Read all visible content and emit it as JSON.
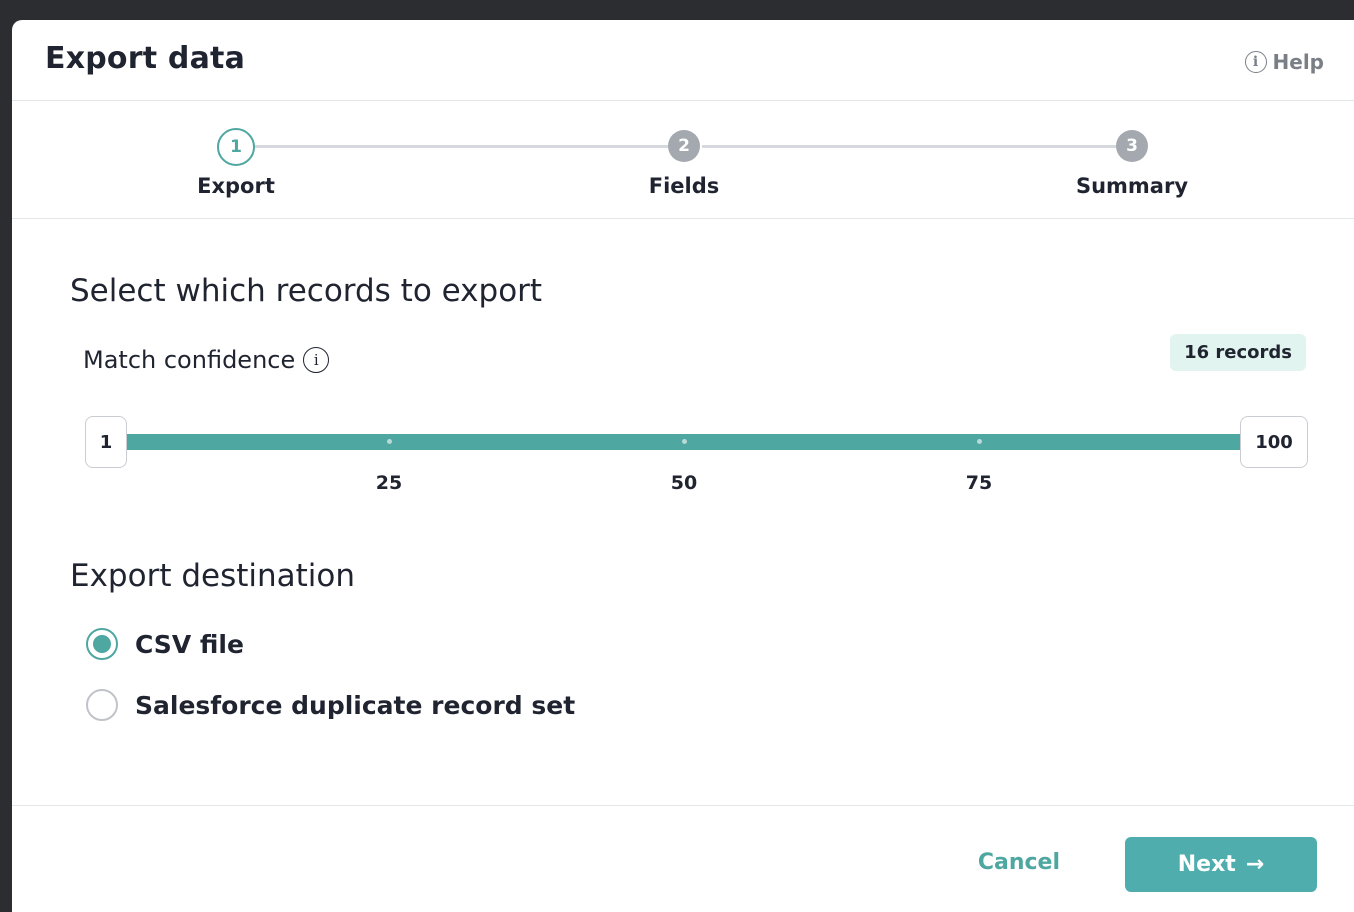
{
  "modal": {
    "title": "Export data",
    "help_label": "Help",
    "help_icon": "info-icon"
  },
  "stepper": {
    "steps": [
      {
        "number": "1",
        "label": "Export",
        "state": "active"
      },
      {
        "number": "2",
        "label": "Fields",
        "state": "inactive"
      },
      {
        "number": "3",
        "label": "Summary",
        "state": "inactive"
      }
    ]
  },
  "records_section": {
    "title": "Select which records to export",
    "match_label": "Match confidence",
    "match_icon": "info-icon",
    "records_badge": "16 records"
  },
  "slider": {
    "min_value": "1",
    "max_value": "100",
    "tick_labels": [
      "25",
      "50",
      "75"
    ],
    "range_fill_fraction": 1.0,
    "accent_color": "#4ea7a0"
  },
  "destination": {
    "title": "Export destination",
    "options": [
      {
        "label": "CSV file",
        "selected": true
      },
      {
        "label": "Salesforce duplicate record set",
        "selected": false
      }
    ]
  },
  "footer": {
    "cancel_label": "Cancel",
    "next_label": "Next",
    "next_icon": "arrow-right-icon",
    "accent_color": "#4fadad"
  }
}
